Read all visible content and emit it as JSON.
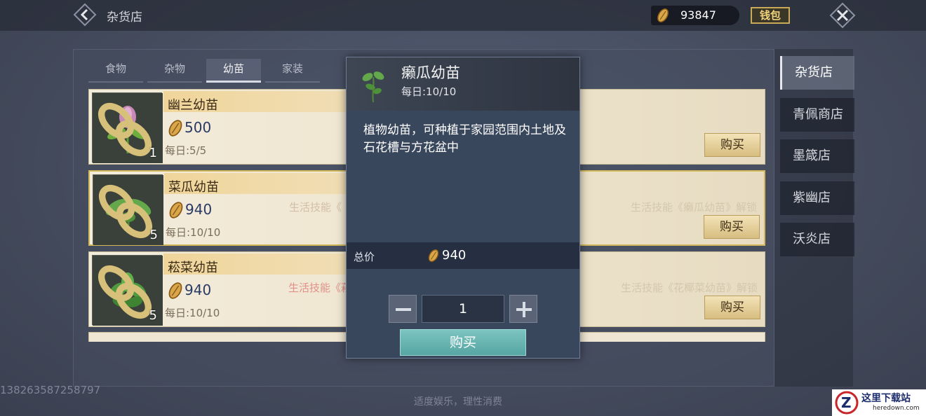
{
  "header": {
    "title": "杂货店",
    "currency_amount": "93847",
    "wallet_label": "钱包"
  },
  "tabs": [
    {
      "label": "食物",
      "active": false
    },
    {
      "label": "杂物",
      "active": false
    },
    {
      "label": "幼苗",
      "active": true
    },
    {
      "label": "家装",
      "active": false
    }
  ],
  "items": [
    {
      "name": "幽兰幼苗",
      "price": "500",
      "daily": "每日:5/5",
      "count": "1",
      "unlock_left": "",
      "unlock_right": "",
      "buy_label": "购买"
    },
    {
      "name": "菜瓜幼苗",
      "price": "940",
      "daily": "每日:10/10",
      "count": "5",
      "unlock_left": "生活技能《",
      "unlock_right": "生活技能《癞瓜幼苗》解锁",
      "buy_label": "购买"
    },
    {
      "name": "菘菜幼苗",
      "price": "940",
      "daily": "每日:10/10",
      "count": "5",
      "unlock_left": "生活技能《菘",
      "unlock_right": "生活技能《花椰菜幼苗》解锁",
      "buy_label": "购买"
    }
  ],
  "side_shops": [
    {
      "label": "杂货店",
      "active": true
    },
    {
      "label": "青佩商店",
      "active": false
    },
    {
      "label": "墨箴店",
      "active": false
    },
    {
      "label": "紫幽店",
      "active": false
    },
    {
      "label": "沃炎店",
      "active": false
    }
  ],
  "popup": {
    "title": "癞瓜幼苗",
    "daily": "每日:10/10",
    "description": "植物幼苗，可种植于家园范围内土地及石花槽与方花盆中",
    "total_label": "总价",
    "total_value": "940",
    "quantity": "1",
    "buy_label": "购买"
  },
  "footer": {
    "player_id": "13826358725879​7",
    "notice": "适度娱乐，理性消费"
  },
  "watermark": {
    "text": "这里下载站",
    "sub": "heredown.com"
  },
  "colors": {
    "accent_gold": "#c8aa58",
    "confirm_teal": "#56a6a4",
    "price_blue": "#2a3a66",
    "unlock_red": "#e1908a"
  }
}
